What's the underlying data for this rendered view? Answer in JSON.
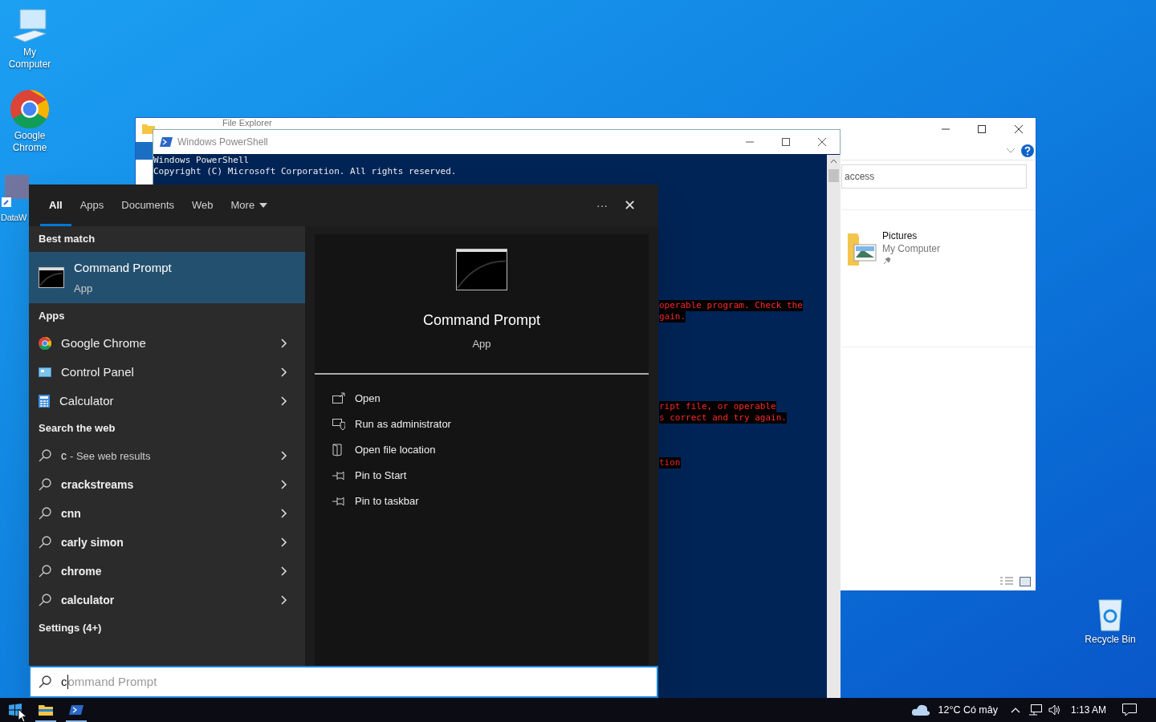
{
  "desktop_icons": [
    {
      "label": "My Computer",
      "kind": "computer"
    },
    {
      "label": "Google Chrome",
      "kind": "chrome"
    },
    {
      "label": "DataW",
      "kind": "data"
    },
    {
      "label": "Recycle Bin",
      "kind": "bin"
    }
  ],
  "explorer": {
    "title": "File Explorer",
    "search_value": "access",
    "pinned": {
      "name": "Pictures",
      "location": "My Computer"
    }
  },
  "powershell": {
    "title": "Windows PowerShell",
    "lines": [
      "Windows PowerShell",
      "Copyright (C) Microsoft Corporation. All rights reserved."
    ],
    "errors": [
      [
        "operable program. Check the",
        "gain."
      ],
      [
        "ript file, or operable",
        "s correct and try again."
      ],
      [
        "tion"
      ]
    ]
  },
  "search": {
    "tabs": [
      {
        "label": "All",
        "selected": true
      },
      {
        "label": "Apps",
        "selected": false
      },
      {
        "label": "Documents",
        "selected": false
      },
      {
        "label": "Web",
        "selected": false
      },
      {
        "label": "More",
        "selected": false,
        "kind": "dropdown"
      }
    ],
    "more_icon": "···",
    "close_icon": "✕",
    "best_match_heading": "Best match",
    "best_match": {
      "name": "Command Prompt",
      "type": "App",
      "selected": true
    },
    "apps_heading": "Apps",
    "apps": [
      {
        "label": "Google Chrome",
        "kind": "chrome"
      },
      {
        "label": "Control Panel",
        "kind": "control"
      },
      {
        "label": "Calculator",
        "kind": "calculator"
      }
    ],
    "web_heading": "Search the web",
    "web": [
      {
        "query": "c",
        "hint": "- See web results"
      },
      {
        "query": "crackstreams"
      },
      {
        "query": "cnn"
      },
      {
        "query": "carly simon"
      },
      {
        "query": "chrome"
      },
      {
        "query": "calculator"
      }
    ],
    "settings_heading": "Settings (4+)",
    "preview": {
      "name": "Command Prompt",
      "type": "App",
      "actions": [
        {
          "label": "Open",
          "kind": "open"
        },
        {
          "label": "Run as administrator",
          "kind": "admin"
        },
        {
          "label": "Open file location",
          "kind": "folder"
        },
        {
          "label": "Pin to Start",
          "kind": "pin"
        },
        {
          "label": "Pin to taskbar",
          "kind": "pin"
        }
      ]
    },
    "field": {
      "value": "c",
      "completion": "ommand Prompt"
    }
  },
  "taskbar": {
    "apps": [
      {
        "kind": "start",
        "active": false
      },
      {
        "kind": "explorer",
        "active": true
      },
      {
        "kind": "powershell",
        "active": true
      }
    ],
    "weather": "12°C Có mây",
    "time": "1:13 AM"
  }
}
